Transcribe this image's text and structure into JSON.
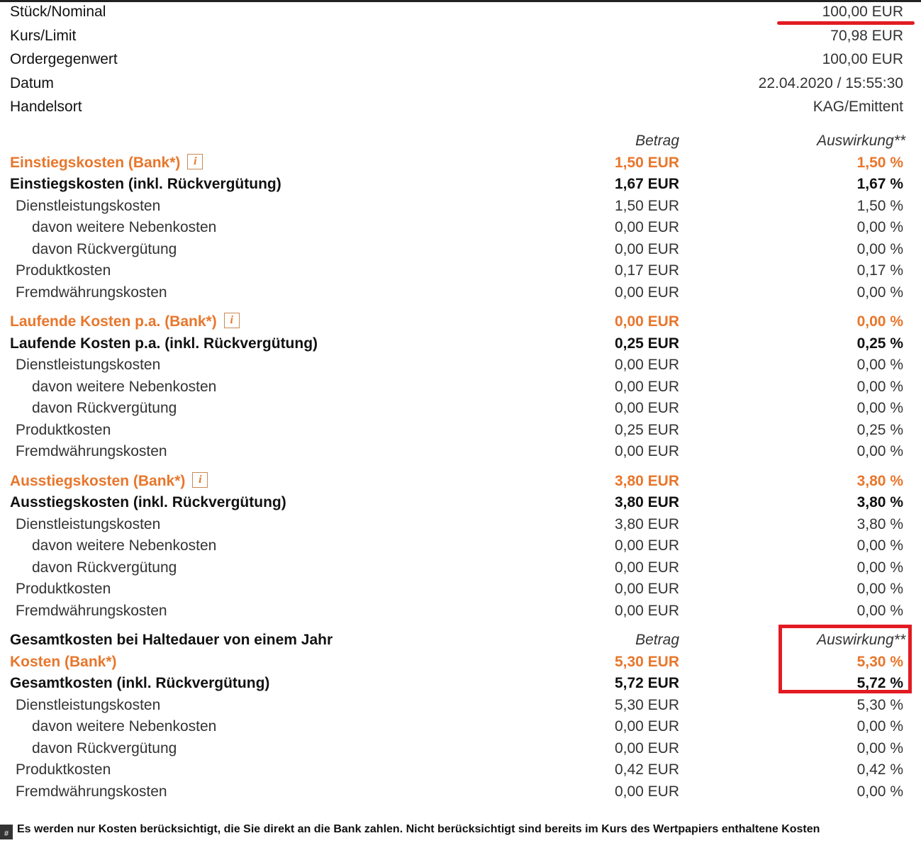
{
  "info": [
    {
      "label": "Stück/Nominal",
      "value": "100,00 EUR"
    },
    {
      "label": "Kurs/Limit",
      "value": "70,98 EUR"
    },
    {
      "label": "Ordergegenwert",
      "value": "100,00 EUR"
    },
    {
      "label": "Datum",
      "value": "22.04.2020 / 15:55:30"
    },
    {
      "label": "Handelsort",
      "value": "KAG/Emittent"
    }
  ],
  "headers": {
    "betrag": "Betrag",
    "auswirkung": "Auswirkung**"
  },
  "sections": [
    {
      "bank": {
        "label": "Einstiegskosten (Bank*)",
        "betrag": "1,50 EUR",
        "auswirkung": "1,50 %"
      },
      "total": {
        "label": "Einstiegskosten (inkl. Rückvergütung)",
        "betrag": "1,67 EUR",
        "auswirkung": "1,67 %"
      },
      "rows": [
        {
          "label": "Dienstleistungskosten",
          "betrag": "1,50 EUR",
          "auswirkung": "1,50 %"
        },
        {
          "label": "davon weitere Nebenkosten",
          "betrag": "0,00 EUR",
          "auswirkung": "0,00 %"
        },
        {
          "label": "davon Rückvergütung",
          "betrag": "0,00 EUR",
          "auswirkung": "0,00 %"
        },
        {
          "label": "Produktkosten",
          "betrag": "0,17 EUR",
          "auswirkung": "0,17 %"
        },
        {
          "label": "Fremdwährungskosten",
          "betrag": "0,00 EUR",
          "auswirkung": "0,00 %"
        }
      ]
    },
    {
      "bank": {
        "label": "Laufende Kosten p.a. (Bank*)",
        "betrag": "0,00 EUR",
        "auswirkung": "0,00 %"
      },
      "total": {
        "label": "Laufende Kosten p.a. (inkl. Rückvergütung)",
        "betrag": "0,25 EUR",
        "auswirkung": "0,25 %"
      },
      "rows": [
        {
          "label": "Dienstleistungskosten",
          "betrag": "0,00 EUR",
          "auswirkung": "0,00 %"
        },
        {
          "label": "davon weitere Nebenkosten",
          "betrag": "0,00 EUR",
          "auswirkung": "0,00 %"
        },
        {
          "label": "davon Rückvergütung",
          "betrag": "0,00 EUR",
          "auswirkung": "0,00 %"
        },
        {
          "label": "Produktkosten",
          "betrag": "0,25 EUR",
          "auswirkung": "0,25 %"
        },
        {
          "label": "Fremdwährungskosten",
          "betrag": "0,00 EUR",
          "auswirkung": "0,00 %"
        }
      ]
    },
    {
      "bank": {
        "label": "Ausstiegskosten (Bank*)",
        "betrag": "3,80 EUR",
        "auswirkung": "3,80 %"
      },
      "total": {
        "label": "Ausstiegskosten (inkl. Rückvergütung)",
        "betrag": "3,80 EUR",
        "auswirkung": "3,80 %"
      },
      "rows": [
        {
          "label": "Dienstleistungskosten",
          "betrag": "3,80 EUR",
          "auswirkung": "3,80 %"
        },
        {
          "label": "davon weitere Nebenkosten",
          "betrag": "0,00 EUR",
          "auswirkung": "0,00 %"
        },
        {
          "label": "davon Rückvergütung",
          "betrag": "0,00 EUR",
          "auswirkung": "0,00 %"
        },
        {
          "label": "Produktkosten",
          "betrag": "0,00 EUR",
          "auswirkung": "0,00 %"
        },
        {
          "label": "Fremdwährungskosten",
          "betrag": "0,00 EUR",
          "auswirkung": "0,00 %"
        }
      ]
    }
  ],
  "gesamt": {
    "title": "Gesamtkosten bei Haltedauer von einem Jahr",
    "bank": {
      "label": "Kosten (Bank*)",
      "betrag": "5,30 EUR",
      "auswirkung": "5,30 %"
    },
    "total": {
      "label": "Gesamtkosten (inkl. Rückvergütung)",
      "betrag": "5,72 EUR",
      "auswirkung": "5,72 %"
    },
    "rows": [
      {
        "label": "Dienstleistungskosten",
        "betrag": "5,30 EUR",
        "auswirkung": "5,30 %"
      },
      {
        "label": "davon weitere Nebenkosten",
        "betrag": "0,00 EUR",
        "auswirkung": "0,00 %"
      },
      {
        "label": "davon Rückvergütung",
        "betrag": "0,00 EUR",
        "auswirkung": "0,00 %"
      },
      {
        "label": "Produktkosten",
        "betrag": "0,42 EUR",
        "auswirkung": "0,42 %"
      },
      {
        "label": "Fremdwährungskosten",
        "betrag": "0,00 EUR",
        "auswirkung": "0,00 %"
      }
    ]
  },
  "info_icon": "i",
  "hash_badge": "#",
  "footnote": "Es werden nur Kosten berücksichtigt, die Sie direkt an die Bank zahlen. Nicht berücksichtigt sind bereits im Kurs des Wertpapiers enthaltene Kosten",
  "colors": {
    "orange": "#e8762b",
    "highlight": "#e21b23"
  }
}
